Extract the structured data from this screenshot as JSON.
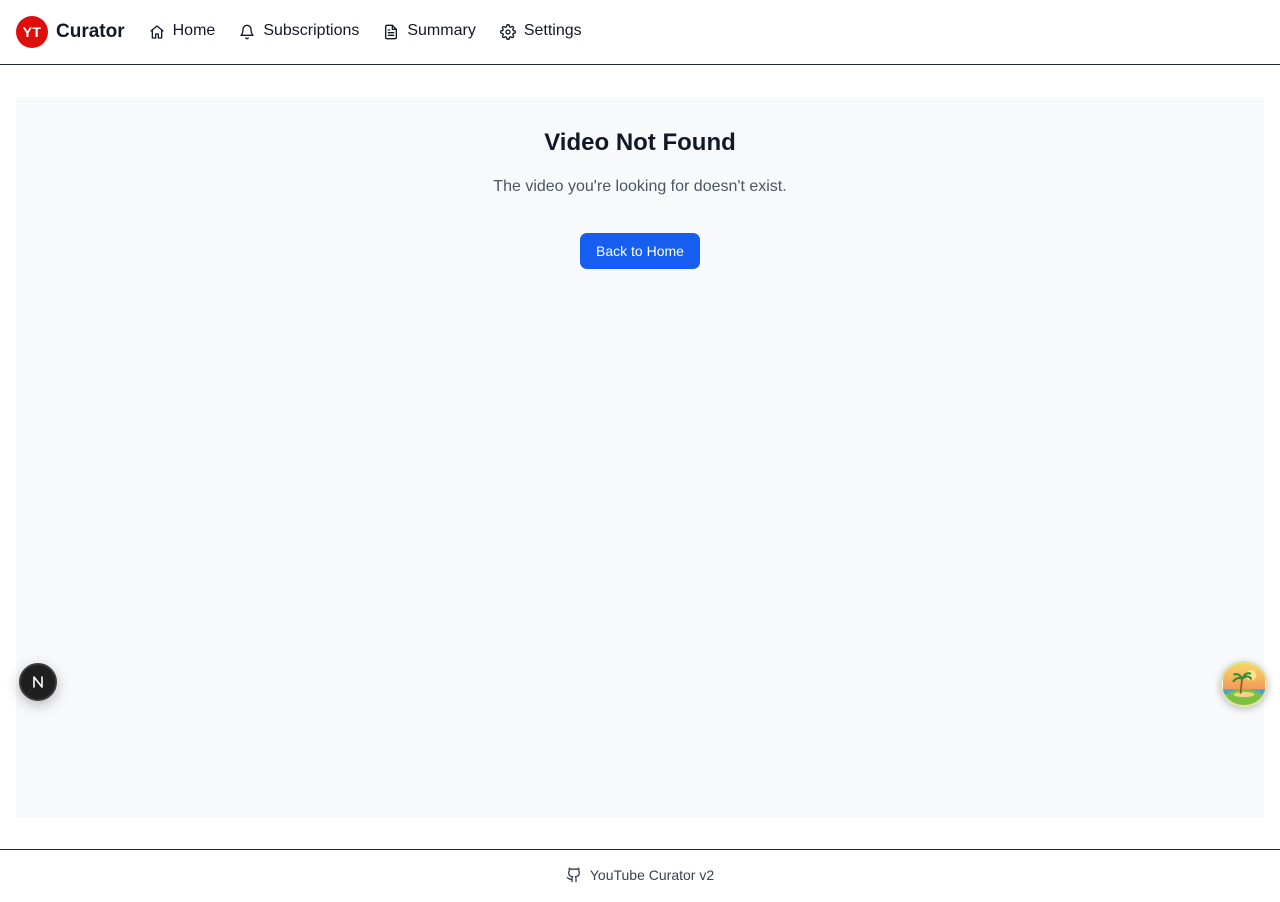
{
  "app": {
    "badge": "YT",
    "name": "Curator",
    "brand_color": "#e00d0d"
  },
  "nav": {
    "items": [
      {
        "label": "Home",
        "icon": "home-icon"
      },
      {
        "label": "Subscriptions",
        "icon": "bell-icon"
      },
      {
        "label": "Summary",
        "icon": "document-icon"
      },
      {
        "label": "Settings",
        "icon": "gear-icon"
      }
    ]
  },
  "main": {
    "title": "Video Not Found",
    "message": "The video you're looking for doesn't exist.",
    "back_label": "Back to Home",
    "button_color": "#155eef"
  },
  "floating": {
    "devtools_glyph": "N",
    "assistant_icon": "island-avatar-icon"
  },
  "footer": {
    "icon": "github-icon",
    "text": "YouTube Curator v2"
  }
}
